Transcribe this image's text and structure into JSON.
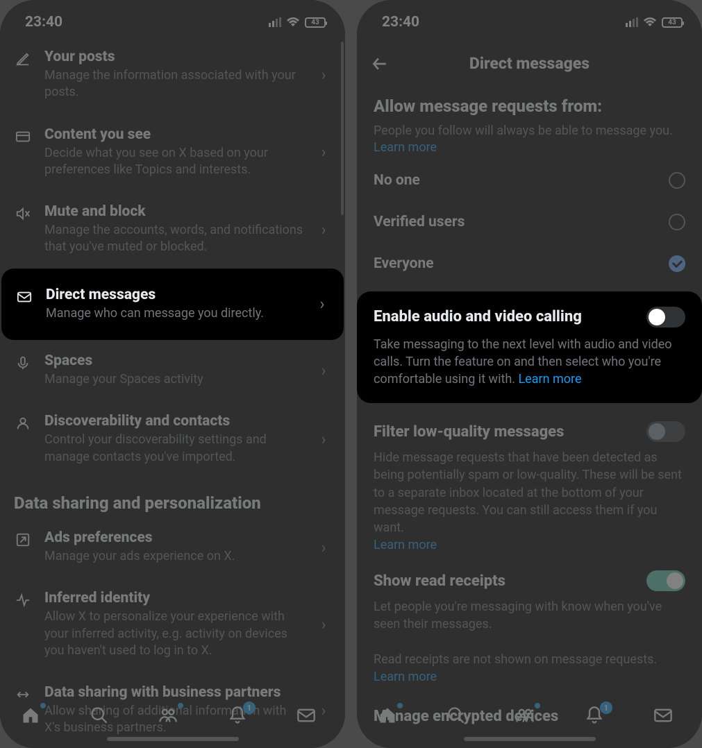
{
  "status": {
    "time": "23:40",
    "battery": "43"
  },
  "left": {
    "items": [
      {
        "title": "Your posts",
        "desc": "Manage the information associated with your posts."
      },
      {
        "title": "Content you see",
        "desc": "Decide what you see on X based on your preferences like Topics and interests."
      },
      {
        "title": "Mute and block",
        "desc": "Manage the accounts, words, and notifications that you've muted or blocked."
      },
      {
        "title": "Direct messages",
        "desc": "Manage who can message you directly."
      },
      {
        "title": "Spaces",
        "desc": "Manage your Spaces activity"
      },
      {
        "title": "Discoverability and contacts",
        "desc": "Control your discoverability settings and manage contacts you've imported."
      }
    ],
    "section": "Data sharing and personalization",
    "items2": [
      {
        "title": "Ads preferences",
        "desc": "Manage your ads experience on X."
      },
      {
        "title": "Inferred identity",
        "desc": "Allow X to personalize your experience with your inferred activity, e.g. activity on devices you haven't used to log in to X."
      },
      {
        "title": "Data sharing with business partners",
        "desc": "Allow sharing of additional information with X's business partners."
      }
    ]
  },
  "right": {
    "header": "Direct messages",
    "allow": {
      "title": "Allow message requests from:",
      "sub": "People you follow will always be able to message you.",
      "learn": "Learn more",
      "options": [
        "No one",
        "Verified users",
        "Everyone"
      ],
      "selectedIndex": 2
    },
    "calling": {
      "title": "Enable audio and video calling",
      "desc": "Take messaging to the next level with audio and video calls. Turn the feature on and then select who you're comfortable using it with. ",
      "learn": "Learn more",
      "enabled": false
    },
    "filter": {
      "title": "Filter low-quality messages",
      "desc": "Hide message requests that have been detected as being potentially spam or low-quality. These will be sent to a separate inbox located at the bottom of your message requests. You can still access them if you want.",
      "learn": "Learn more",
      "enabled": false
    },
    "receipts": {
      "title": "Show read receipts",
      "desc1": "Let people you're messaging with know when you've seen their messages.",
      "desc2": "Read receipts are not shown on message requests.",
      "learn": "Learn more",
      "enabled": true
    },
    "encrypted": "Manage encrypted devices",
    "nav_badge": "1"
  }
}
